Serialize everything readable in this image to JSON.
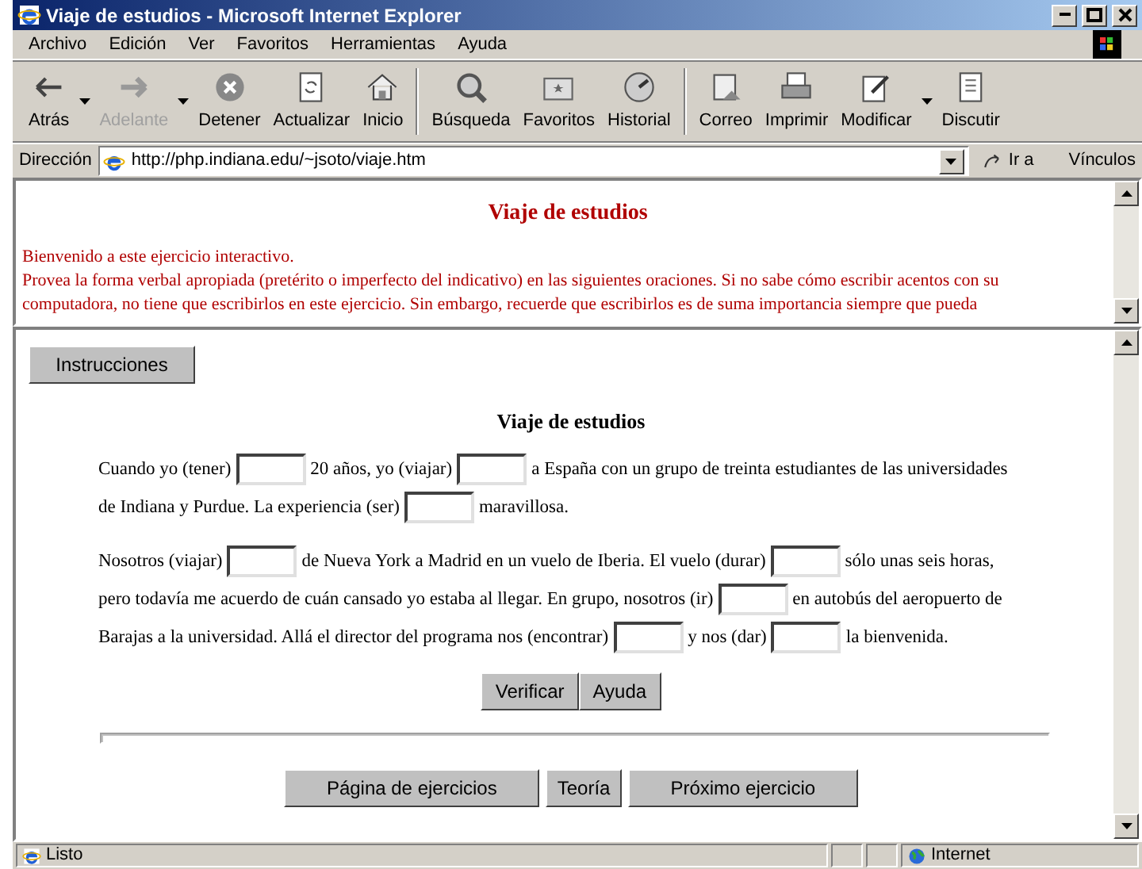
{
  "window": {
    "title": "Viaje de estudios - Microsoft Internet Explorer"
  },
  "menu": [
    "Archivo",
    "Edición",
    "Ver",
    "Favoritos",
    "Herramientas",
    "Ayuda"
  ],
  "toolbar": [
    {
      "label": "Atrás",
      "kind": "back",
      "disabled": false,
      "dropdown": true
    },
    {
      "label": "Adelante",
      "kind": "forward",
      "disabled": true,
      "dropdown": true
    },
    {
      "label": "Detener",
      "kind": "stop",
      "disabled": false,
      "dropdown": false
    },
    {
      "label": "Actualizar",
      "kind": "refresh",
      "disabled": false,
      "dropdown": false
    },
    {
      "label": "Inicio",
      "kind": "home",
      "disabled": false,
      "dropdown": false
    },
    {
      "label": "Búsqueda",
      "kind": "search",
      "disabled": false,
      "dropdown": false
    },
    {
      "label": "Favoritos",
      "kind": "favorites",
      "disabled": false,
      "dropdown": false
    },
    {
      "label": "Historial",
      "kind": "history",
      "disabled": false,
      "dropdown": false
    },
    {
      "label": "Correo",
      "kind": "mail",
      "disabled": false,
      "dropdown": false
    },
    {
      "label": "Imprimir",
      "kind": "print",
      "disabled": false,
      "dropdown": false
    },
    {
      "label": "Modificar",
      "kind": "edit",
      "disabled": false,
      "dropdown": true
    },
    {
      "label": "Discutir",
      "kind": "discuss",
      "disabled": false,
      "dropdown": false
    }
  ],
  "address": {
    "label": "Dirección",
    "value": "http://php.indiana.edu/~jsoto/viaje.htm",
    "go": "Ir a",
    "links": "Vínculos"
  },
  "top_frame": {
    "title": "Viaje de estudios",
    "lines": [
      "Bienvenido a este ejercicio interactivo.",
      "Provea la forma verbal apropiada (pretérito o imperfecto del indicativo) en las siguientes oraciones. Si no sabe cómo escribir acentos con su",
      "computadora, no tiene que escribirlos en este ejercicio. Sin embargo, recuerde que escribirlos es de suma importancia siempre que pueda"
    ]
  },
  "main_frame": {
    "instructions_button": "Instrucciones",
    "title": "Viaje de estudios",
    "paragraphs": [
      [
        {
          "kind": "text",
          "text": "Cuando yo (tener)"
        },
        {
          "kind": "blank"
        },
        {
          "kind": "text",
          "text": "20 años, yo (viajar)"
        },
        {
          "kind": "blank"
        },
        {
          "kind": "text",
          "text": "a España con un grupo de treinta estudiantes de las universidades"
        },
        {
          "kind": "break"
        },
        {
          "kind": "text",
          "text": "de Indiana y Purdue. La experiencia (ser)"
        },
        {
          "kind": "blank"
        },
        {
          "kind": "text",
          "text": "maravillosa."
        }
      ],
      [
        {
          "kind": "text",
          "text": "Nosotros (viajar)"
        },
        {
          "kind": "blank"
        },
        {
          "kind": "text",
          "text": "de Nueva York a Madrid en un vuelo de Iberia. El vuelo (durar)"
        },
        {
          "kind": "blank"
        },
        {
          "kind": "text",
          "text": "sólo unas seis horas,"
        },
        {
          "kind": "break"
        },
        {
          "kind": "text",
          "text": "pero todavía me acuerdo de cuán cansado yo estaba al llegar. En grupo, nosotros (ir)"
        },
        {
          "kind": "blank"
        },
        {
          "kind": "text",
          "text": "en autobús del aeropuerto de"
        },
        {
          "kind": "break"
        },
        {
          "kind": "text",
          "text": "Barajas a la universidad. Allá el director del programa nos (encontrar)"
        },
        {
          "kind": "blank"
        },
        {
          "kind": "text",
          "text": "y nos (dar)"
        },
        {
          "kind": "blank"
        },
        {
          "kind": "text",
          "text": "la bienvenida."
        }
      ]
    ],
    "check_buttons": [
      "Verificar",
      "Ayuda"
    ],
    "nav_buttons": [
      "Página de ejercicios",
      "Teoría",
      "Próximo ejercicio"
    ]
  },
  "status_bar": {
    "text": "Listo",
    "zone": "Internet"
  }
}
